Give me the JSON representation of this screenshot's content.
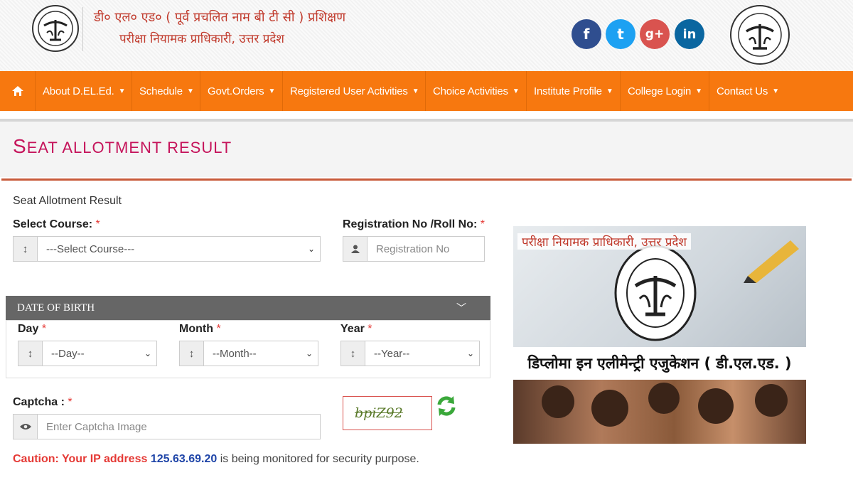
{
  "header": {
    "title_line1": "डी० एल० एड० ( पूर्व प्रचलित नाम बी टी सी ) प्रशिक्षण",
    "title_line2": "परीक्षा नियामक प्राधिकारी, उत्तर प्रदेश",
    "social": [
      "f",
      "t",
      "g+",
      "in"
    ]
  },
  "nav": {
    "items": [
      "About D.EL.Ed.",
      "Schedule",
      "Govt.Orders",
      "Registered User Activities",
      "Choice Activities",
      "Institute Profile",
      "College Login",
      "Contact Us"
    ]
  },
  "page": {
    "title_first": "S",
    "title_rest": "EAT ALLOTMENT RESULT",
    "subtitle": "Seat Allotment Result"
  },
  "form": {
    "course_label": "Select Course:",
    "course_value": "---Select Course---",
    "reg_label": "Registration No /Roll No:",
    "reg_placeholder": "Registration No",
    "dob_header": "DATE OF BIRTH",
    "day_label": "Day",
    "day_value": "--Day--",
    "month_label": "Month",
    "month_value": "--Month--",
    "year_label": "Year",
    "year_value": "--Year--",
    "captcha_label": "Captcha :",
    "captcha_placeholder": "Enter Captcha Image",
    "captcha_text": "bpiZ92",
    "required_mark": "*"
  },
  "caution": {
    "prefix": "Caution: Your IP address",
    "ip": "125.63.69.20",
    "suffix": "is being monitored for security purpose."
  },
  "promo": {
    "heading": "परीक्षा नियामक प्राधिकारी, उत्तर प्रदेश",
    "caption": "डिप्लोमा इन एलीमेन्ट्री एजुकेशन ( डी.एल.एड. )"
  },
  "colors": {
    "nav": "#f7780f",
    "title": "#c5135a",
    "accent_red": "#e53935"
  }
}
